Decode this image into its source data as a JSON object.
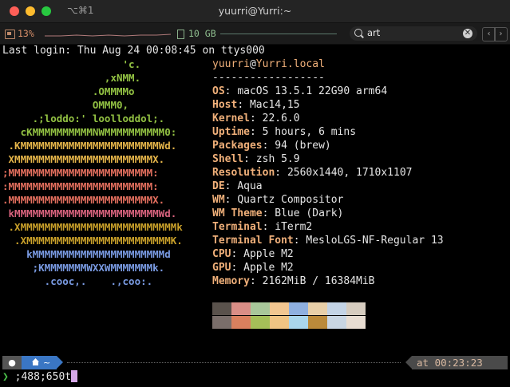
{
  "window": {
    "shortcut": "⌥⌘1",
    "title": "yuurri@Yurri:~"
  },
  "statusbar": {
    "cpu": "13%",
    "memory": "10 GB",
    "search_value": "art"
  },
  "terminal": {
    "last_login": "Last login: Thu Aug 24 00:08:45 on ttys000",
    "logo": [
      {
        "text": "                    'c.",
        "color": "#93c243"
      },
      {
        "text": "                 ,xNMM.",
        "color": "#93c243"
      },
      {
        "text": "               .OMMMMo",
        "color": "#93c243"
      },
      {
        "text": "               OMMM0,",
        "color": "#93c243"
      },
      {
        "text": "     .;loddo:' loolloddol;.",
        "color": "#93c243"
      },
      {
        "text": "   cKMMMMMMMMMMNWMMMMMMMMMM0:",
        "color": "#93c243"
      },
      {
        "text": " .KMMMMMMMMMMMMMMMMMMMMMMMWd.",
        "color": "#e5b54a"
      },
      {
        "text": " XMMMMMMMMMMMMMMMMMMMMMMMX.",
        "color": "#e5b54a"
      },
      {
        "text": ";MMMMMMMMMMMMMMMMMMMMMMMM:",
        "color": "#e36f5e"
      },
      {
        "text": ":MMMMMMMMMMMMMMMMMMMMMMMM:",
        "color": "#e36f5e"
      },
      {
        "text": ".MMMMMMMMMMMMMMMMMMMMMMMMX.",
        "color": "#e36f5e"
      },
      {
        "text": " kMMMMMMMMMMMMMMMMMMMMMMMMWd.",
        "color": "#d9637e"
      },
      {
        "text": " .XMMMMMMMMMMMMMMMMMMMMMMMMMMk",
        "color": "#c9a02a"
      },
      {
        "text": "  .XMMMMMMMMMMMMMMMMMMMMMMMMK.",
        "color": "#c9a02a"
      },
      {
        "text": "    kMMMMMMMMMMMMMMMMMMMMMMd",
        "color": "#7a9be3"
      },
      {
        "text": "     ;KMMMMMMMWXXWMMMMMMMk.",
        "color": "#7a9be3"
      },
      {
        "text": "       .cooc,.    .,coo:.",
        "color": "#7a9be3"
      }
    ],
    "user": "yuurri",
    "at": "@",
    "host": "Yurri.local",
    "separator": "------------------",
    "info": [
      {
        "key": "OS",
        "value": "macOS 13.5.1 22G90 arm64"
      },
      {
        "key": "Host",
        "value": "Mac14,15"
      },
      {
        "key": "Kernel",
        "value": "22.6.0"
      },
      {
        "key": "Uptime",
        "value": "5 hours, 6 mins"
      },
      {
        "key": "Packages",
        "value": "94 (brew)"
      },
      {
        "key": "Shell",
        "value": "zsh 5.9"
      },
      {
        "key": "Resolution",
        "value": "2560x1440, 1710x1107"
      },
      {
        "key": "DE",
        "value": "Aqua"
      },
      {
        "key": "WM",
        "value": "Quartz Compositor"
      },
      {
        "key": "WM Theme",
        "value": "Blue (Dark)"
      },
      {
        "key": "Terminal",
        "value": "iTerm2"
      },
      {
        "key": "Terminal Font",
        "value": "MesloLGS-NF-Regular 13"
      },
      {
        "key": "CPU",
        "value": "Apple M2"
      },
      {
        "key": "GPU",
        "value": "Apple M2"
      },
      {
        "key": "Memory",
        "value": "2162MiB / 16384MiB"
      }
    ],
    "palette_top": [
      "#5a524c",
      "#d98e86",
      "#a9c79a",
      "#f2c690",
      "#8fb0e0",
      "#e8cfa8",
      "#c4d4e6",
      "#d6ccbf"
    ],
    "palette_bottom": [
      "#7a6e6a",
      "#d9805e",
      "#a5bf58",
      "#f0c483",
      "#aad6ec",
      "#bb8a3a",
      "#c9d6e3",
      "#e8ddd2"
    ]
  },
  "prompt": {
    "apple_icon": "apple-icon",
    "dir": "~",
    "time": "at 00:23:23",
    "command": ";488;650t",
    "prompt_char": "❯"
  }
}
